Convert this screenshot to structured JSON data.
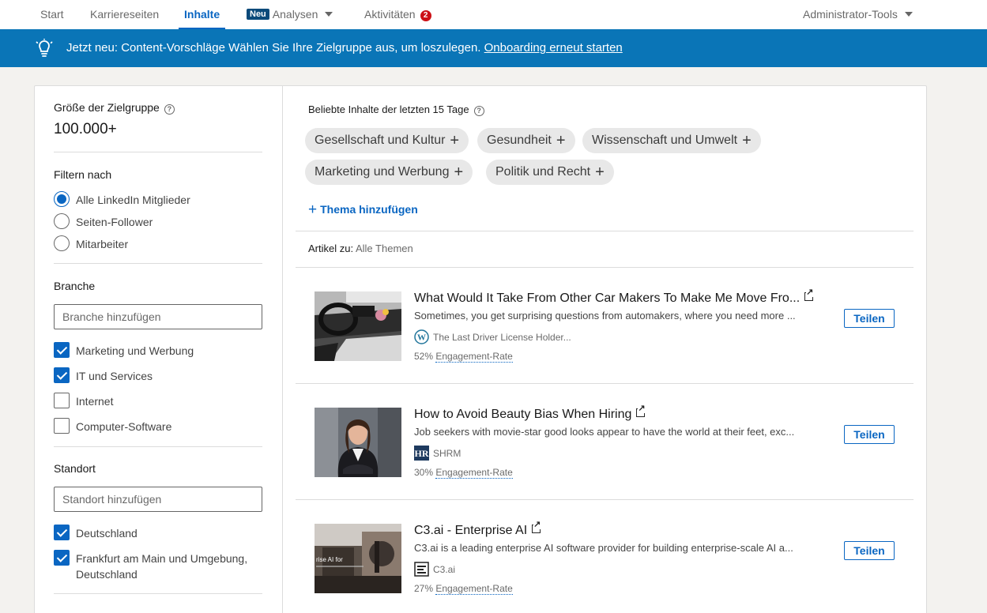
{
  "nav": {
    "tabs": [
      {
        "label": "Start"
      },
      {
        "label": "Karriereseiten"
      },
      {
        "label": "Inhalte"
      },
      {
        "badge": "Neu",
        "label": "Analysen"
      },
      {
        "label": "Aktivitäten",
        "count": "2"
      }
    ],
    "admin_tools": "Administrator-Tools"
  },
  "banner": {
    "text": "Jetzt neu: Content-Vorschläge Wählen Sie Ihre Zielgruppe aus, um loszulegen.",
    "link": "Onboarding erneut starten"
  },
  "sidebar": {
    "audience_size_label": "Größe der Zielgruppe",
    "audience_size_value": "100.000+",
    "filter_label": "Filtern nach",
    "filter_options": [
      {
        "label": "Alle LinkedIn Mitglieder",
        "selected": true
      },
      {
        "label": "Seiten-Follower",
        "selected": false
      },
      {
        "label": "Mitarbeiter",
        "selected": false
      }
    ],
    "industry_label": "Branche",
    "industry_placeholder": "Branche hinzufügen",
    "industries": [
      {
        "label": "Marketing und Werbung",
        "checked": true
      },
      {
        "label": "IT und Services",
        "checked": true
      },
      {
        "label": "Internet",
        "checked": false
      },
      {
        "label": "Computer-Software",
        "checked": false
      }
    ],
    "location_label": "Standort",
    "location_placeholder": "Standort hinzufügen",
    "locations": [
      {
        "label": "Deutschland",
        "checked": true
      },
      {
        "label": "Frankfurt am Main und Umgebung,",
        "label2": "Deutschland",
        "checked": true
      }
    ]
  },
  "main": {
    "popular_title": "Beliebte Inhalte der letzten 15 Tage",
    "topics": [
      {
        "label": "Gesellschaft und Kultur"
      },
      {
        "label": "Gesundheit"
      },
      {
        "label": "Wissenschaft und Umwelt"
      },
      {
        "label": "Marketing und Werbung"
      },
      {
        "label": "Politik und Recht"
      }
    ],
    "add_topic": "Thema hinzufügen",
    "articles_for_label": "Artikel zu:",
    "articles_for_value": "Alle Themen",
    "share_label": "Teilen",
    "rate_suffix": "Engagement-Rate",
    "articles": [
      {
        "title": "What Would It Take From Other Car Makers To Make Me Move Fro...",
        "description": "Sometimes, you get surprising questions from automakers, where you need more ...",
        "source": "The Last Driver License Holder...",
        "source_icon": "wordpress-icon",
        "rate": "52%"
      },
      {
        "title": "How to Avoid Beauty Bias When Hiring",
        "description": "Job seekers with movie-star good looks appear to have the world at their feet, exc...",
        "source": "SHRM",
        "source_icon": "shrm-logo-icon",
        "rate": "30%"
      },
      {
        "title": "C3.ai - Enterprise AI",
        "description": "C3.ai is a leading enterprise AI software provider for building enterprise-scale AI a...",
        "source": "C3.ai",
        "source_icon": "c3ai-logo-icon",
        "rate": "27%",
        "thumb_text": "rise AI for"
      }
    ]
  },
  "colors": {
    "brand": "#0a66c2",
    "banner": "#0a75b7",
    "badge_red": "#cc1016"
  }
}
